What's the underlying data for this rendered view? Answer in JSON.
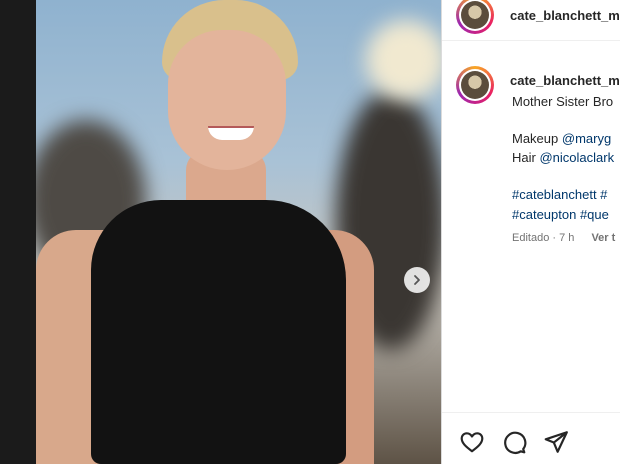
{
  "post": {
    "username": "cate_blanchett_m",
    "caption_username": "cate_blanchett_m",
    "caption_lines": [
      "Mother Sister Bro"
    ],
    "makeup_label": "Makeup",
    "makeup_handle": "@maryg",
    "hair_label": "Hair",
    "hair_handle": "@nicolaclark",
    "hashtag_line1": "#cateblanchett #",
    "hashtag_line2": "#cateupton #que",
    "meta": "Editado · 7 h",
    "see_translation": "Ver t"
  },
  "icons": {
    "carousel_next": "chevron-right-icon",
    "like": "heart-icon",
    "comment": "comment-icon",
    "share": "send-icon"
  }
}
